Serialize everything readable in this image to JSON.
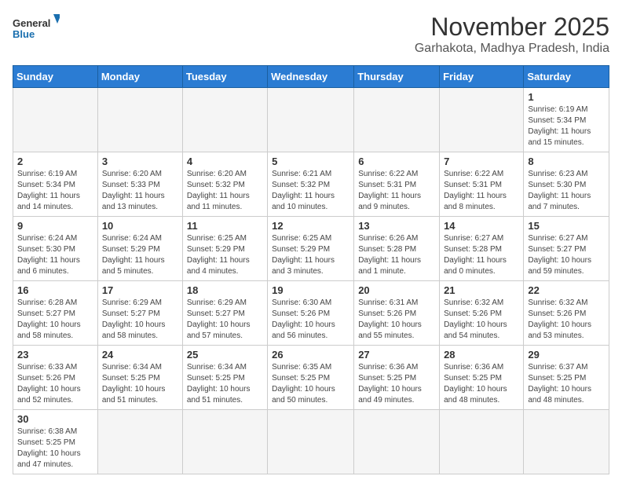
{
  "header": {
    "logo_general": "General",
    "logo_blue": "Blue",
    "month_title": "November 2025",
    "location": "Garhakota, Madhya Pradesh, India"
  },
  "weekdays": [
    "Sunday",
    "Monday",
    "Tuesday",
    "Wednesday",
    "Thursday",
    "Friday",
    "Saturday"
  ],
  "days": {
    "d1": {
      "num": "1",
      "info": "Sunrise: 6:19 AM\nSunset: 5:34 PM\nDaylight: 11 hours\nand 15 minutes."
    },
    "d2": {
      "num": "2",
      "info": "Sunrise: 6:19 AM\nSunset: 5:34 PM\nDaylight: 11 hours\nand 14 minutes."
    },
    "d3": {
      "num": "3",
      "info": "Sunrise: 6:20 AM\nSunset: 5:33 PM\nDaylight: 11 hours\nand 13 minutes."
    },
    "d4": {
      "num": "4",
      "info": "Sunrise: 6:20 AM\nSunset: 5:32 PM\nDaylight: 11 hours\nand 11 minutes."
    },
    "d5": {
      "num": "5",
      "info": "Sunrise: 6:21 AM\nSunset: 5:32 PM\nDaylight: 11 hours\nand 10 minutes."
    },
    "d6": {
      "num": "6",
      "info": "Sunrise: 6:22 AM\nSunset: 5:31 PM\nDaylight: 11 hours\nand 9 minutes."
    },
    "d7": {
      "num": "7",
      "info": "Sunrise: 6:22 AM\nSunset: 5:31 PM\nDaylight: 11 hours\nand 8 minutes."
    },
    "d8": {
      "num": "8",
      "info": "Sunrise: 6:23 AM\nSunset: 5:30 PM\nDaylight: 11 hours\nand 7 minutes."
    },
    "d9": {
      "num": "9",
      "info": "Sunrise: 6:24 AM\nSunset: 5:30 PM\nDaylight: 11 hours\nand 6 minutes."
    },
    "d10": {
      "num": "10",
      "info": "Sunrise: 6:24 AM\nSunset: 5:29 PM\nDaylight: 11 hours\nand 5 minutes."
    },
    "d11": {
      "num": "11",
      "info": "Sunrise: 6:25 AM\nSunset: 5:29 PM\nDaylight: 11 hours\nand 4 minutes."
    },
    "d12": {
      "num": "12",
      "info": "Sunrise: 6:25 AM\nSunset: 5:29 PM\nDaylight: 11 hours\nand 3 minutes."
    },
    "d13": {
      "num": "13",
      "info": "Sunrise: 6:26 AM\nSunset: 5:28 PM\nDaylight: 11 hours\nand 1 minute."
    },
    "d14": {
      "num": "14",
      "info": "Sunrise: 6:27 AM\nSunset: 5:28 PM\nDaylight: 11 hours\nand 0 minutes."
    },
    "d15": {
      "num": "15",
      "info": "Sunrise: 6:27 AM\nSunset: 5:27 PM\nDaylight: 10 hours\nand 59 minutes."
    },
    "d16": {
      "num": "16",
      "info": "Sunrise: 6:28 AM\nSunset: 5:27 PM\nDaylight: 10 hours\nand 58 minutes."
    },
    "d17": {
      "num": "17",
      "info": "Sunrise: 6:29 AM\nSunset: 5:27 PM\nDaylight: 10 hours\nand 58 minutes."
    },
    "d18": {
      "num": "18",
      "info": "Sunrise: 6:29 AM\nSunset: 5:27 PM\nDaylight: 10 hours\nand 57 minutes."
    },
    "d19": {
      "num": "19",
      "info": "Sunrise: 6:30 AM\nSunset: 5:26 PM\nDaylight: 10 hours\nand 56 minutes."
    },
    "d20": {
      "num": "20",
      "info": "Sunrise: 6:31 AM\nSunset: 5:26 PM\nDaylight: 10 hours\nand 55 minutes."
    },
    "d21": {
      "num": "21",
      "info": "Sunrise: 6:32 AM\nSunset: 5:26 PM\nDaylight: 10 hours\nand 54 minutes."
    },
    "d22": {
      "num": "22",
      "info": "Sunrise: 6:32 AM\nSunset: 5:26 PM\nDaylight: 10 hours\nand 53 minutes."
    },
    "d23": {
      "num": "23",
      "info": "Sunrise: 6:33 AM\nSunset: 5:26 PM\nDaylight: 10 hours\nand 52 minutes."
    },
    "d24": {
      "num": "24",
      "info": "Sunrise: 6:34 AM\nSunset: 5:25 PM\nDaylight: 10 hours\nand 51 minutes."
    },
    "d25": {
      "num": "25",
      "info": "Sunrise: 6:34 AM\nSunset: 5:25 PM\nDaylight: 10 hours\nand 51 minutes."
    },
    "d26": {
      "num": "26",
      "info": "Sunrise: 6:35 AM\nSunset: 5:25 PM\nDaylight: 10 hours\nand 50 minutes."
    },
    "d27": {
      "num": "27",
      "info": "Sunrise: 6:36 AM\nSunset: 5:25 PM\nDaylight: 10 hours\nand 49 minutes."
    },
    "d28": {
      "num": "28",
      "info": "Sunrise: 6:36 AM\nSunset: 5:25 PM\nDaylight: 10 hours\nand 48 minutes."
    },
    "d29": {
      "num": "29",
      "info": "Sunrise: 6:37 AM\nSunset: 5:25 PM\nDaylight: 10 hours\nand 48 minutes."
    },
    "d30": {
      "num": "30",
      "info": "Sunrise: 6:38 AM\nSunset: 5:25 PM\nDaylight: 10 hours\nand 47 minutes."
    }
  }
}
